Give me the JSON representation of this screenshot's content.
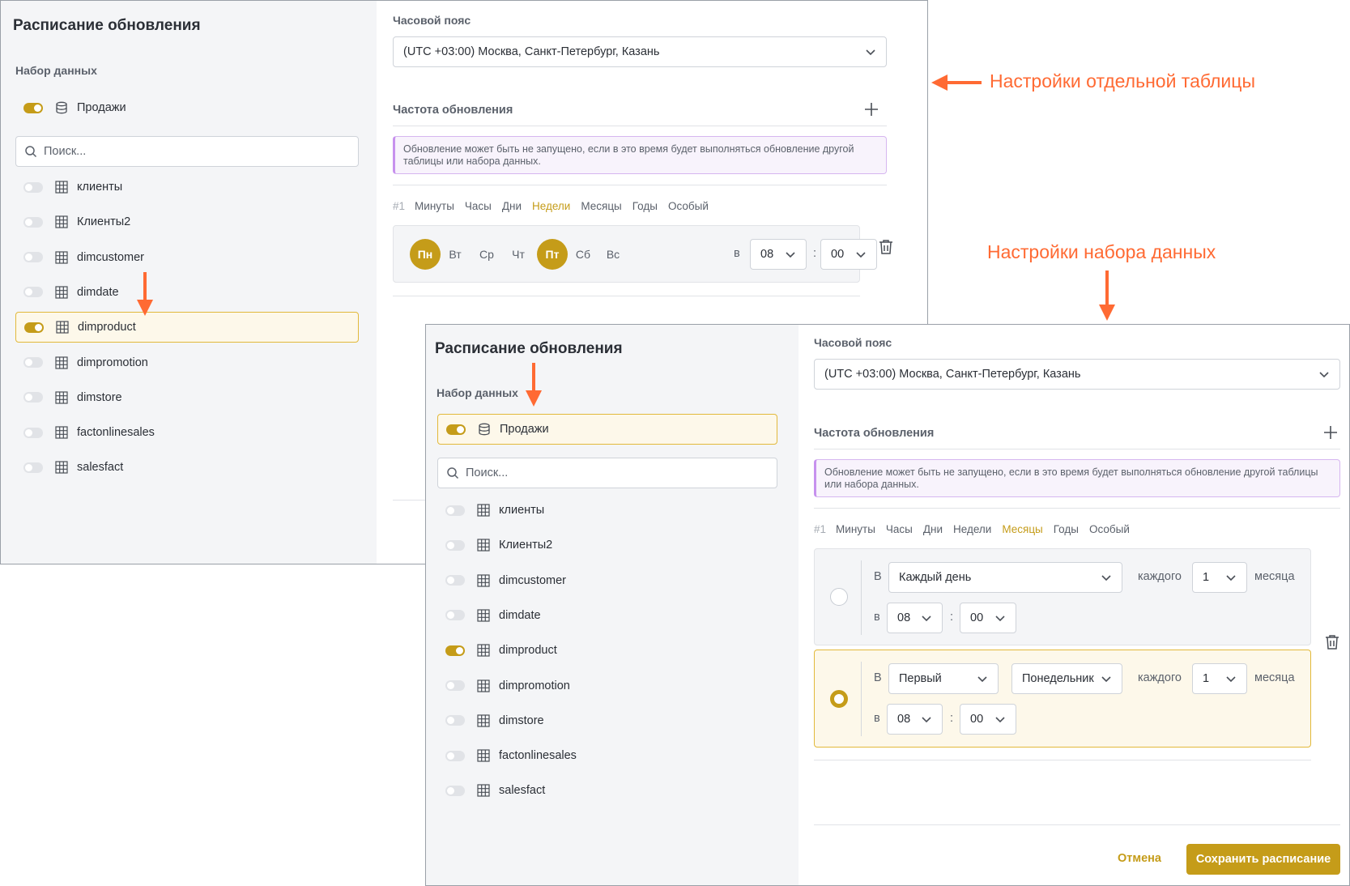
{
  "colors": {
    "accent": "#c59c19",
    "annotation": "#ff6a33",
    "notice_border": "#c791ee"
  },
  "annotations": {
    "table_settings": "Настройки отдельной таблицы",
    "dataset_settings": "Настройки набора данных"
  },
  "shot1": {
    "title": "Расписание обновления",
    "dataset_label": "Набор данных",
    "dataset": {
      "name": "Продажи",
      "enabled": true,
      "icon": "database-icon"
    },
    "search_placeholder": "Поиск...",
    "tables": [
      {
        "name": "клиенты",
        "enabled": false
      },
      {
        "name": "Клиенты2",
        "enabled": false
      },
      {
        "name": "dimcustomer",
        "enabled": false
      },
      {
        "name": "dimdate",
        "enabled": false
      },
      {
        "name": "dimproduct",
        "enabled": true
      },
      {
        "name": "dimpromotion",
        "enabled": false
      },
      {
        "name": "dimstore",
        "enabled": false
      },
      {
        "name": "factonlinesales",
        "enabled": false
      },
      {
        "name": "salesfact",
        "enabled": false
      }
    ],
    "timezone_label": "Часовой пояс",
    "timezone_value": "(UTC +03:00) Москва, Санкт-Петербург, Казань",
    "frequency_label": "Частота обновления",
    "notice": "Обновление может быть не запущено, если в это время будет выполняться обновление другой таблицы или набора данных.",
    "schedule_num": "#1",
    "tabs": [
      "Минуты",
      "Часы",
      "Дни",
      "Недели",
      "Месяцы",
      "Годы",
      "Особый"
    ],
    "active_tab": "Недели",
    "days": [
      {
        "label": "Пн",
        "on": true
      },
      {
        "label": "Вт",
        "on": false
      },
      {
        "label": "Ср",
        "on": false
      },
      {
        "label": "Чт",
        "on": false
      },
      {
        "label": "Пт",
        "on": true
      },
      {
        "label": "Сб",
        "on": false
      },
      {
        "label": "Вс",
        "on": false
      }
    ],
    "at_label": "в",
    "hour": "08",
    "colon": ":",
    "minute": "00"
  },
  "shot2": {
    "title": "Расписание обновления",
    "dataset_label": "Набор данных",
    "dataset": {
      "name": "Продажи",
      "enabled": true,
      "icon": "database-icon"
    },
    "search_placeholder": "Поиск...",
    "tables": [
      {
        "name": "клиенты",
        "enabled": false
      },
      {
        "name": "Клиенты2",
        "enabled": false
      },
      {
        "name": "dimcustomer",
        "enabled": false
      },
      {
        "name": "dimdate",
        "enabled": false
      },
      {
        "name": "dimproduct",
        "enabled": true
      },
      {
        "name": "dimpromotion",
        "enabled": false
      },
      {
        "name": "dimstore",
        "enabled": false
      },
      {
        "name": "factonlinesales",
        "enabled": false
      },
      {
        "name": "salesfact",
        "enabled": false
      }
    ],
    "timezone_label": "Часовой пояс",
    "timezone_value": "(UTC +03:00) Москва, Санкт-Петербург, Казань",
    "frequency_label": "Частота обновления",
    "notice": "Обновление может быть не запущено, если в это время будет выполняться обновление другой таблицы или набора данных.",
    "schedule_num": "#1",
    "tabs": [
      "Минуты",
      "Часы",
      "Дни",
      "Недели",
      "Месяцы",
      "Годы",
      "Особый"
    ],
    "active_tab": "Месяцы",
    "option1": {
      "prefix": "В",
      "day_select": "Каждый день",
      "each_label": "каждого",
      "month_num": "1",
      "month_label": "месяца",
      "at_label": "в",
      "hour": "08",
      "colon": ":",
      "minute": "00",
      "selected": false
    },
    "option2": {
      "prefix": "В",
      "ordinal_select": "Первый",
      "weekday_select": "Понедельник",
      "each_label": "каждого",
      "month_num": "1",
      "month_label": "месяца",
      "at_label": "в",
      "hour": "08",
      "colon": ":",
      "minute": "00",
      "selected": true
    },
    "cancel_label": "Отмена",
    "save_label": "Сохранить расписание"
  }
}
